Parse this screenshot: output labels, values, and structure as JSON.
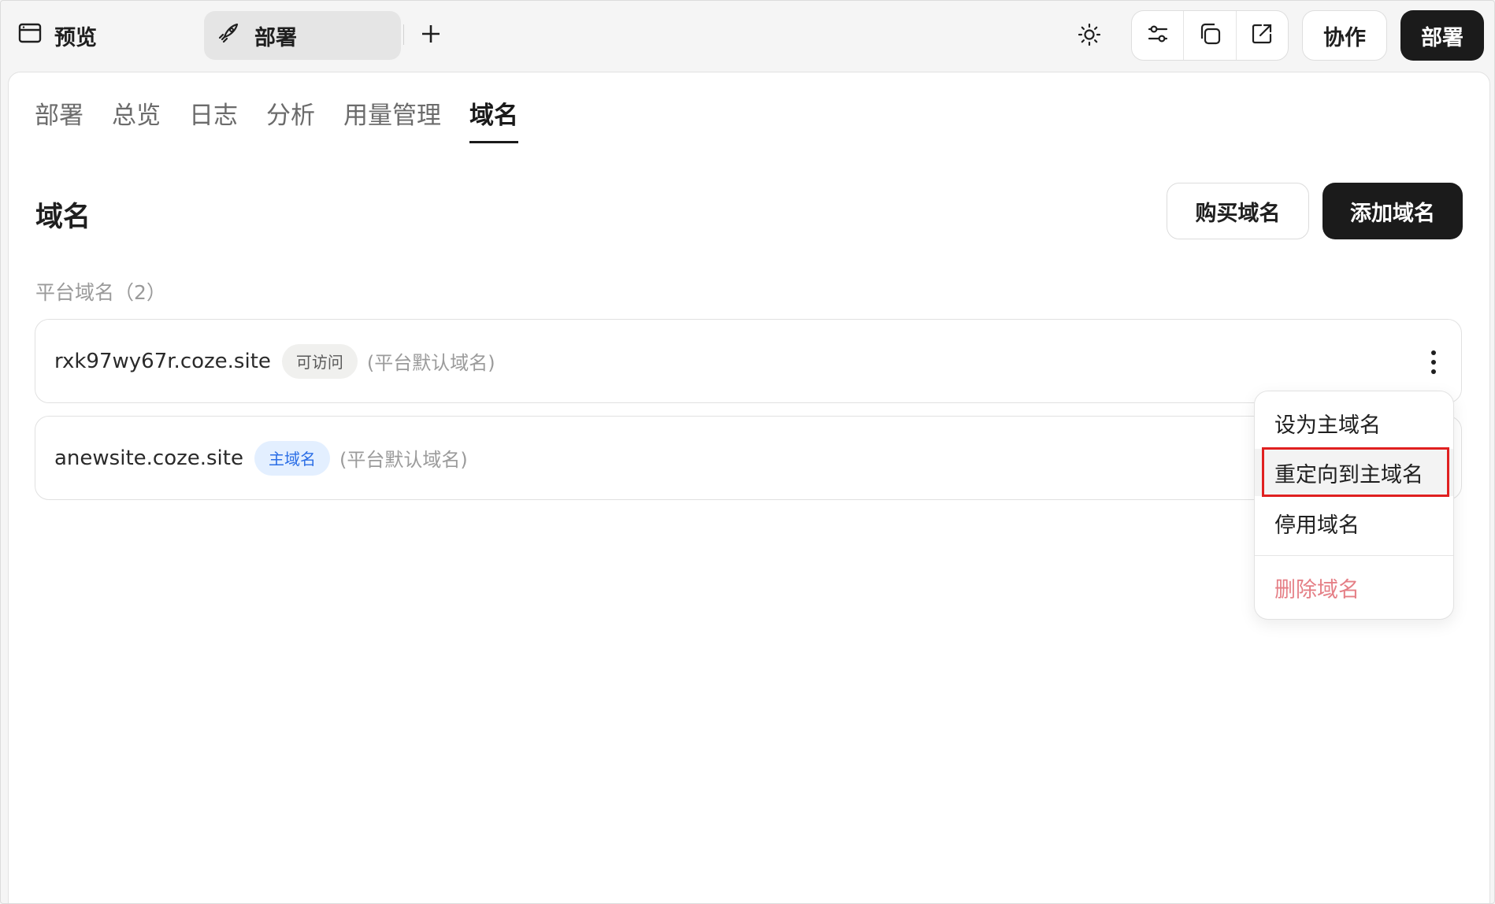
{
  "topbar": {
    "preview_label": "预览",
    "deploy_tab_label": "部署",
    "collab_label": "协作",
    "deploy_button_label": "部署"
  },
  "nav": {
    "tabs": [
      {
        "label": "部署"
      },
      {
        "label": "总览"
      },
      {
        "label": "日志"
      },
      {
        "label": "分析"
      },
      {
        "label": "用量管理"
      },
      {
        "label": "域名",
        "active": true
      }
    ]
  },
  "page": {
    "title": "域名",
    "buy_label": "购买域名",
    "add_label": "添加域名",
    "section_label": "平台域名（2）"
  },
  "domains": [
    {
      "name": "rxk97wy67r.coze.site",
      "badge": "可访问",
      "badge_type": "gray",
      "note": "(平台默认域名)"
    },
    {
      "name": "anewsite.coze.site",
      "badge": "主域名",
      "badge_type": "blue",
      "note": "(平台默认域名)"
    }
  ],
  "menu": {
    "items": [
      {
        "label": "设为主域名"
      },
      {
        "label": "重定向到主域名"
      },
      {
        "label": "停用域名"
      },
      {
        "label": "删除域名"
      }
    ]
  },
  "icons": {
    "preview": "browser-window-icon",
    "deploy": "rocket-icon",
    "add": "plus-icon",
    "theme": "sun-icon",
    "settings": "sliders-icon",
    "copy": "copy-icon",
    "open": "external-link-icon",
    "more": "more-vertical-icon"
  },
  "colors": {
    "primary": "#1b1b1b",
    "danger": "#e57f86",
    "badge_blue": "#2b6ee6",
    "highlight": "#e02020"
  }
}
